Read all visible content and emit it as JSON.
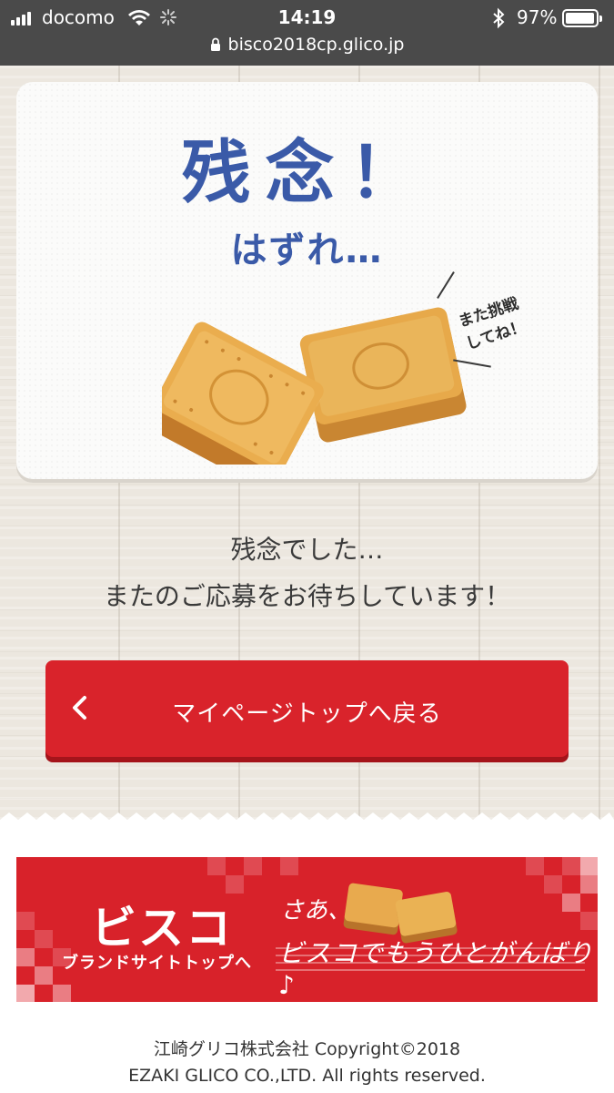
{
  "status_bar": {
    "carrier": "docomo",
    "time": "14:19",
    "battery_percent": "97%",
    "battery_level": 0.97,
    "url": "bisco2018cp.glico.jp"
  },
  "card": {
    "title": "残念！",
    "subtitle": "はずれ…",
    "retry_line1": "また挑戦",
    "retry_line2": "してね！"
  },
  "message": {
    "line1": "残念でした…",
    "line2": "またのご応募をお待ちしています！"
  },
  "back_button": {
    "label": "マイページトップへ戻る"
  },
  "banner": {
    "logo": "ビスコ",
    "brand_link": "ブランドサイトトップへ",
    "tagline1": "さあ、",
    "tagline2": "ビスコでもうひとがんばり♪"
  },
  "footer": {
    "line1": "江崎グリコ株式会社 Copyright©2018",
    "line2": "EZAKI GLICO CO.,LTD. All rights reserved."
  },
  "colors": {
    "accent_red": "#d9232b",
    "title_blue": "#3a5aa8",
    "status_bar": "#4a4a4a"
  },
  "icons": [
    "signal-icon",
    "wifi-icon",
    "loading-spinner-icon",
    "bluetooth-icon",
    "battery-icon",
    "lock-icon",
    "chevron-left-icon"
  ]
}
